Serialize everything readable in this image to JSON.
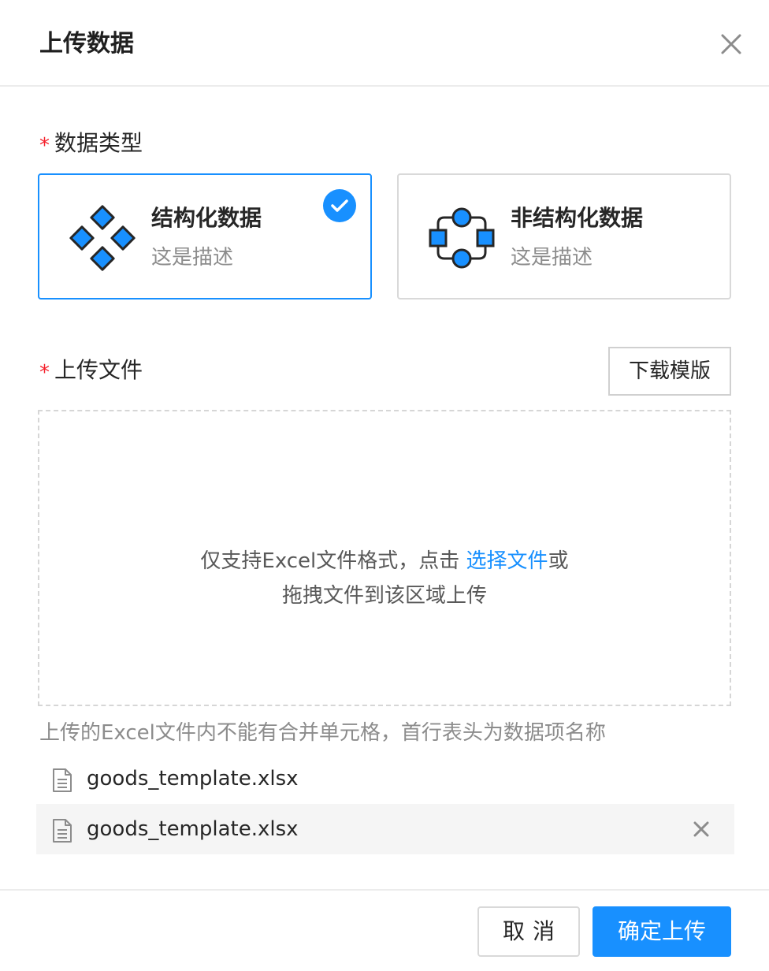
{
  "dialog": {
    "title": "上传数据",
    "close_icon": "close-icon"
  },
  "data_type": {
    "required_mark": "*",
    "label": "数据类型",
    "options": [
      {
        "name": "结构化数据",
        "desc": "这是描述",
        "icon": "structured-data-icon",
        "selected": true
      },
      {
        "name": "非结构化数据",
        "desc": "这是描述",
        "icon": "unstructured-data-icon",
        "selected": false
      }
    ]
  },
  "upload": {
    "required_mark": "*",
    "label": "上传文件",
    "download_template_label": "下载模版",
    "dropzone": {
      "text_before_link": "仅支持Excel文件格式，点击 ",
      "link_text": "选择文件",
      "text_after_link": "或",
      "line2": "拖拽文件到该区域上传"
    },
    "hint": "上传的Excel文件内不能有合并单元格，首行表头为数据项名称",
    "files": [
      {
        "name": "goods_template.xlsx",
        "hovered": false
      },
      {
        "name": "goods_template.xlsx",
        "hovered": true
      }
    ]
  },
  "footer": {
    "cancel_label": "取消",
    "confirm_label": "确定上传"
  },
  "colors": {
    "primary": "#1890ff",
    "required": "#f5222d",
    "icon_fill": "#1890ff",
    "icon_stroke": "#262626"
  }
}
